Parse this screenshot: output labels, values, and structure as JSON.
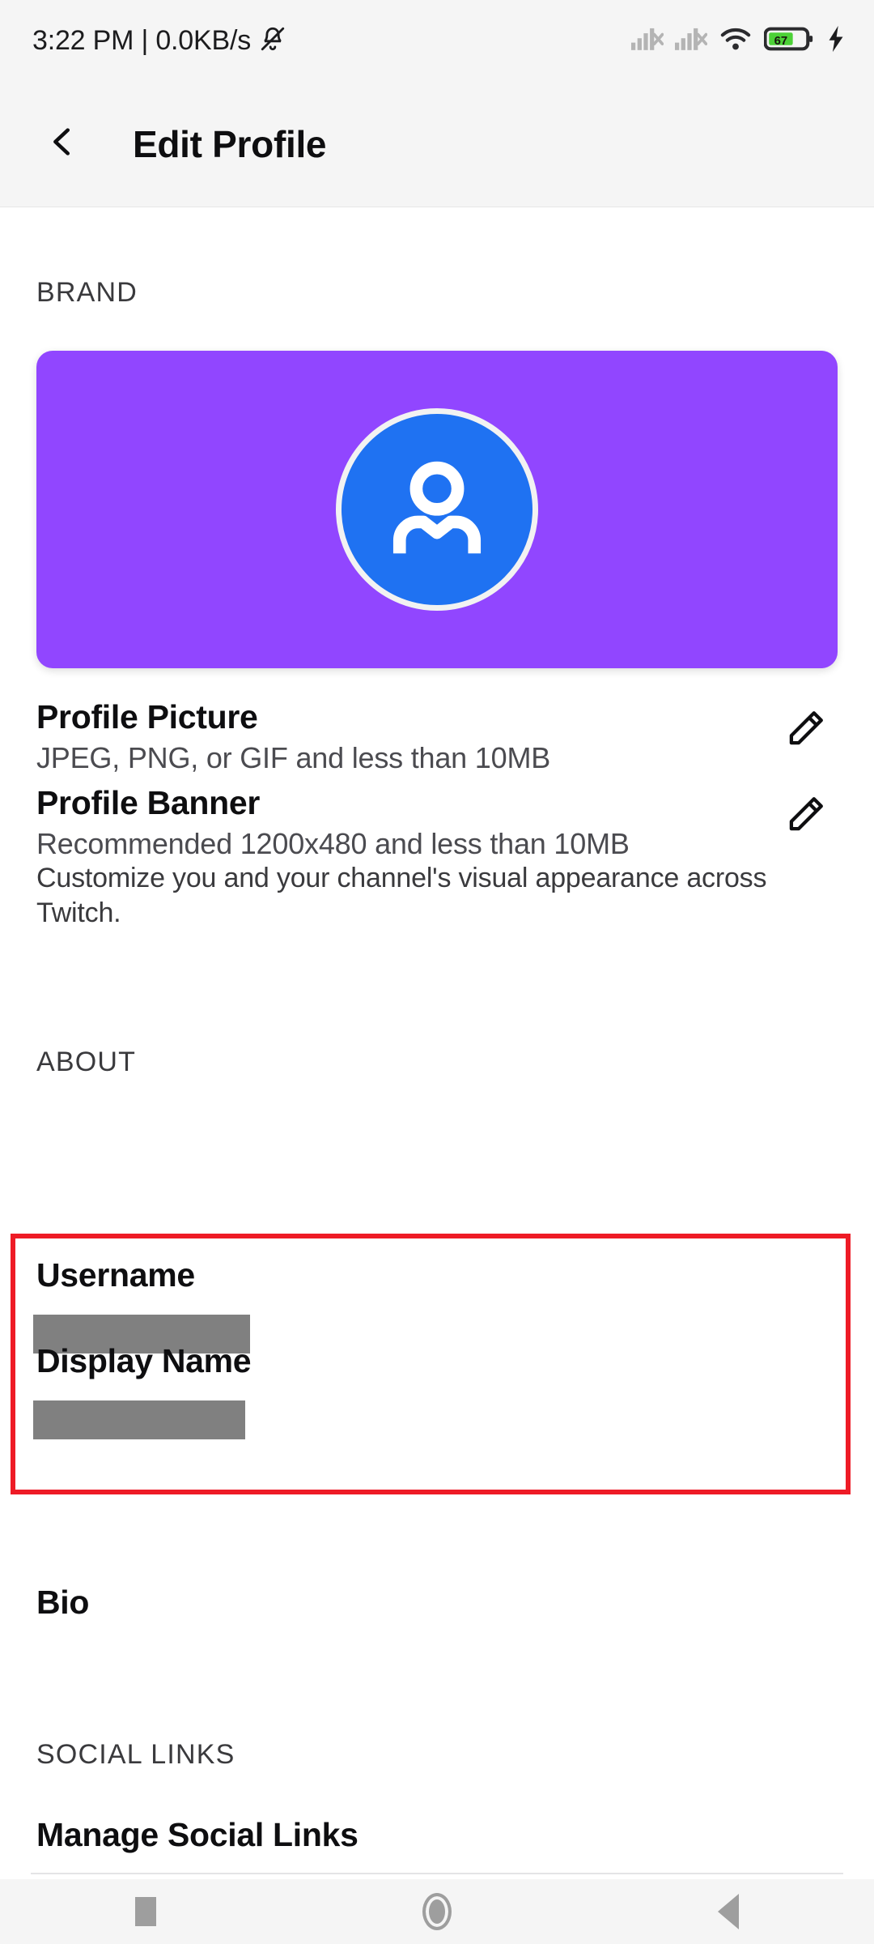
{
  "status_bar": {
    "clock_and_network": "3:22 PM | 0.0KB/s",
    "mute_icon": "bell-muted-icon",
    "signal_1_icon": "signal-no-sim-icon",
    "signal_2_icon": "signal-no-sim-icon",
    "wifi_icon": "wifi-icon",
    "battery_percent": "67",
    "charging_icon": "charging-bolt-icon",
    "battery_fill_color": "#4cd137"
  },
  "app_bar": {
    "back_icon": "chevron-left-icon",
    "title": "Edit Profile"
  },
  "brand": {
    "section_label": "BRAND",
    "banner_color": "#9146ff",
    "avatar_icon": "person-avatar-icon",
    "avatar_color": "#1f72f2",
    "rows": [
      {
        "title": "Profile Picture",
        "subtitle": "JPEG, PNG, or GIF and less than 10MB",
        "action_icon": "pencil-edit-icon"
      },
      {
        "title": "Profile Banner",
        "subtitle": "Recommended 1200x480 and less than 10MB",
        "action_icon": "pencil-edit-icon"
      }
    ],
    "description": "Customize you and your channel's visual appearance across Twitch."
  },
  "about": {
    "section_label": "ABOUT",
    "highlight_color": "#ee1b26",
    "fields": [
      {
        "label": "Username",
        "value": "",
        "redacted": true
      },
      {
        "label": "Display Name",
        "value": "",
        "redacted": true
      }
    ],
    "bio_label": "Bio"
  },
  "social_links": {
    "section_label": "SOCIAL LINKS",
    "manage_label": "Manage Social Links"
  },
  "nav_bar": {
    "recents_icon": "square-recents-icon",
    "home_icon": "circle-home-icon",
    "back_icon": "triangle-back-icon"
  }
}
